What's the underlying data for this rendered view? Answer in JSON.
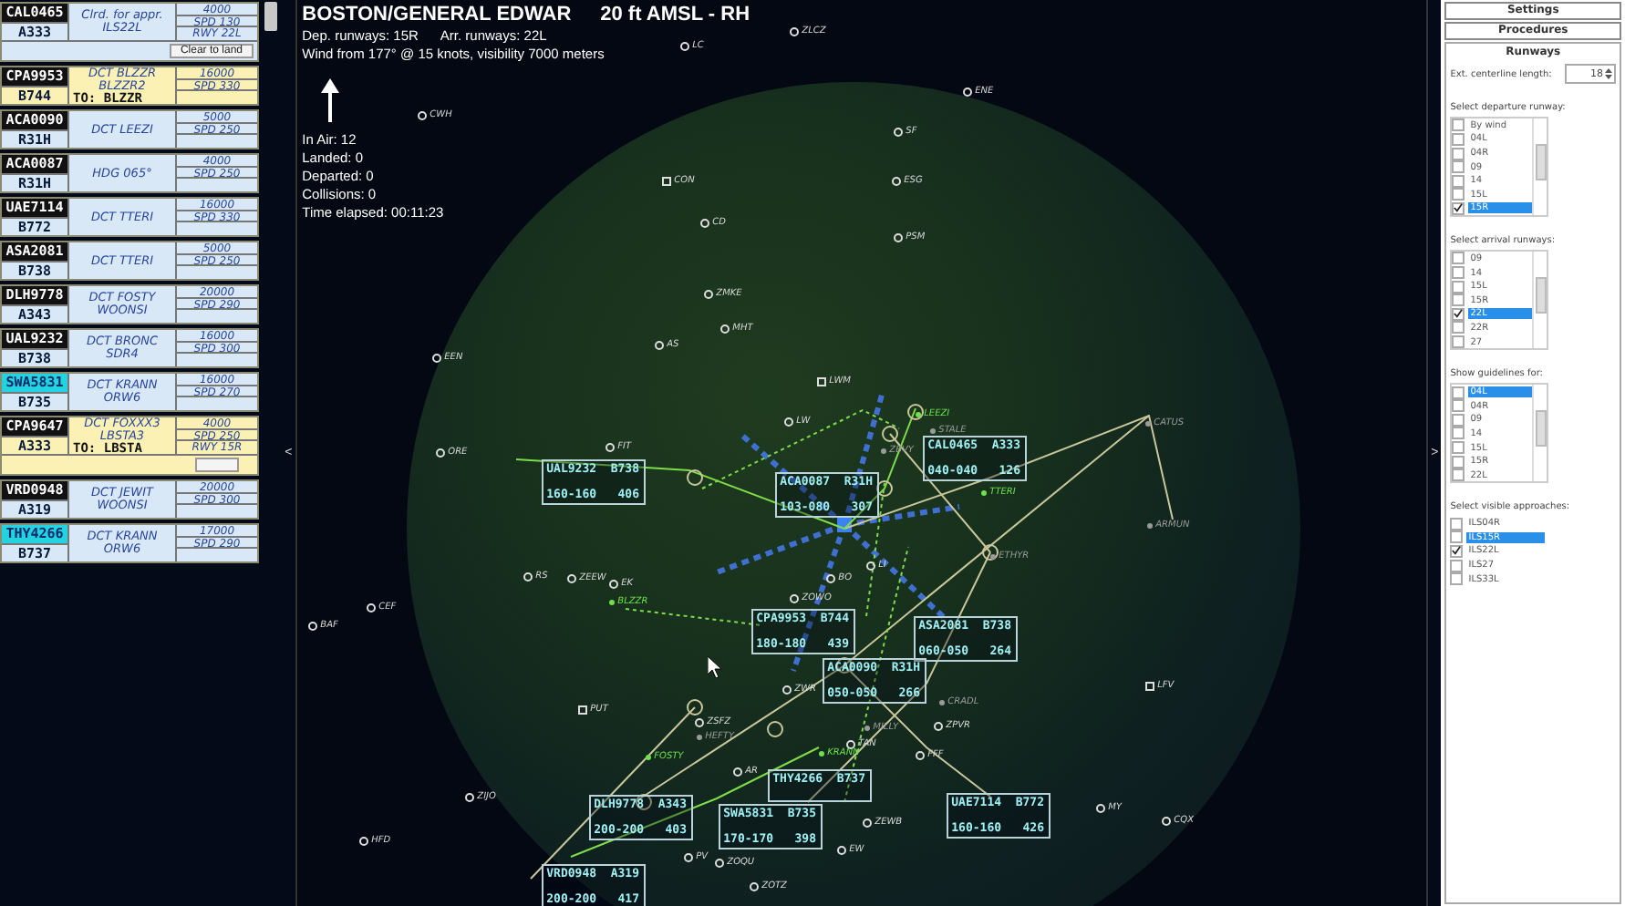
{
  "strips_panel": {
    "strips": [
      {
        "callsign": "CAL0465",
        "type": "A333",
        "kind": "arrival",
        "highlighted": false,
        "route": [
          "Clrd. for appr.",
          "ILS22L"
        ],
        "altitude": "4000",
        "speed": "SPD 130",
        "runway": "RWY 22L",
        "button": "Clear to land"
      },
      {
        "callsign": "CPA9953",
        "type": "B744",
        "kind": "departure",
        "highlighted": false,
        "route": [
          "DCT BLZZR",
          "BLZZR2"
        ],
        "destination": "TO: BLZZR",
        "altitude": "16000",
        "speed": "SPD 330"
      },
      {
        "callsign": "ACA0090",
        "type": "R31H",
        "kind": "arrival",
        "highlighted": false,
        "route": [
          "DCT LEEZI"
        ],
        "altitude": "5000",
        "speed": "SPD 250"
      },
      {
        "callsign": "ACA0087",
        "type": "R31H",
        "kind": "arrival",
        "highlighted": false,
        "route": [
          "HDG 065°"
        ],
        "altitude": "4000",
        "speed": "SPD 250"
      },
      {
        "callsign": "UAE7114",
        "type": "B772",
        "kind": "arrival",
        "highlighted": false,
        "route": [
          "DCT TTERI"
        ],
        "altitude": "16000",
        "speed": "SPD 330"
      },
      {
        "callsign": "ASA2081",
        "type": "B738",
        "kind": "arrival",
        "highlighted": false,
        "route": [
          "DCT TTERI"
        ],
        "altitude": "5000",
        "speed": "SPD 250"
      },
      {
        "callsign": "DLH9778",
        "type": "A343",
        "kind": "arrival",
        "highlighted": false,
        "route": [
          "DCT FOSTY",
          "WOONSI"
        ],
        "altitude": "20000",
        "speed": "SPD 290"
      },
      {
        "callsign": "UAL9232",
        "type": "B738",
        "kind": "arrival",
        "highlighted": false,
        "route": [
          "DCT BRONC",
          "SDR4"
        ],
        "altitude": "16000",
        "speed": "SPD 300"
      },
      {
        "callsign": "SWA5831",
        "type": "B735",
        "kind": "arrival",
        "highlighted": true,
        "route": [
          "DCT KRANN",
          "ORW6"
        ],
        "altitude": "16000",
        "speed": "SPD 270"
      },
      {
        "callsign": "CPA9647",
        "type": "A333",
        "kind": "departure",
        "highlighted": false,
        "route": [
          "DCT FOXXX3",
          "LBSTA3"
        ],
        "destination": "TO: LBSTA",
        "altitude": "4000",
        "speed": "SPD 250",
        "runway": "RWY 15R",
        "blank_button": true
      },
      {
        "callsign": "VRD0948",
        "type": "A319",
        "kind": "arrival",
        "highlighted": false,
        "route": [
          "DCT JEWIT",
          "WOONSI"
        ],
        "altitude": "20000",
        "speed": "SPD 300"
      },
      {
        "callsign": "THY4266",
        "type": "B737",
        "kind": "arrival",
        "highlighted": true,
        "route": [
          "DCT KRANN",
          "ORW6"
        ],
        "altitude": "17000",
        "speed": "SPD 290"
      }
    ]
  },
  "toggle_left": "<",
  "toggle_right": ">",
  "radar": {
    "airport": "BOSTON/GENERAL EDWAR",
    "elevation": "20 ft AMSL - RH",
    "dep_runways": "Dep. runways: 15R",
    "arr_runways": "Arr. runways: 22L",
    "wind": "Wind from 177° @ 15 knots, visibility 7000 meters",
    "stats": [
      "In Air: 12",
      "Landed: 0",
      "Departed: 0",
      "Collisions: 0",
      "Time elapsed: 00:11:23"
    ],
    "navaids": [
      {
        "label": "ZLCZ",
        "kind": "vor"
      },
      {
        "label": "LC",
        "kind": "vor"
      },
      {
        "label": "CWH",
        "kind": "vor"
      },
      {
        "label": "ENE",
        "kind": "vor"
      },
      {
        "label": "SF",
        "kind": "vor"
      },
      {
        "label": "CON",
        "kind": "airport"
      },
      {
        "label": "ESG",
        "kind": "vor"
      },
      {
        "label": "CD",
        "kind": "vor"
      },
      {
        "label": "PSM",
        "kind": "vor"
      },
      {
        "label": "ZMKE",
        "kind": "vor"
      },
      {
        "label": "MHT",
        "kind": "vor"
      },
      {
        "label": "AS",
        "kind": "vor"
      },
      {
        "label": "EEN",
        "kind": "vor"
      },
      {
        "label": "LWM",
        "kind": "airport"
      },
      {
        "label": "LW",
        "kind": "vor"
      },
      {
        "label": "FIT",
        "kind": "vor"
      },
      {
        "label": "ORE",
        "kind": "vor"
      },
      {
        "label": "RS",
        "kind": "vor"
      },
      {
        "label": "ZEEW",
        "kind": "vor"
      },
      {
        "label": "EK",
        "kind": "vor"
      },
      {
        "label": "BAF",
        "kind": "vor"
      },
      {
        "label": "CEF",
        "kind": "vor"
      },
      {
        "label": "ZOWO",
        "kind": "vor"
      },
      {
        "label": "BO",
        "kind": "vor"
      },
      {
        "label": "LI",
        "kind": "vor"
      },
      {
        "label": "ZWR",
        "kind": "vor"
      },
      {
        "label": "PUT",
        "kind": "airport"
      },
      {
        "label": "ZSFZ",
        "kind": "vor"
      },
      {
        "label": "AR",
        "kind": "vor"
      },
      {
        "label": "TAN",
        "kind": "vor"
      },
      {
        "label": "ZPVR",
        "kind": "vor"
      },
      {
        "label": "FFF",
        "kind": "vor"
      },
      {
        "label": "ZEWB",
        "kind": "vor"
      },
      {
        "label": "EW",
        "kind": "vor"
      },
      {
        "label": "PV",
        "kind": "vor"
      },
      {
        "label": "ZOQU",
        "kind": "vor"
      },
      {
        "label": "ZOTZ",
        "kind": "vor"
      },
      {
        "label": "ZIJO",
        "kind": "vor"
      },
      {
        "label": "HFD",
        "kind": "vor"
      },
      {
        "label": "LFV",
        "kind": "airport"
      },
      {
        "label": "MY",
        "kind": "vor"
      },
      {
        "label": "CQX",
        "kind": "vor"
      }
    ],
    "fixes": [
      {
        "label": "LEEZI",
        "kind": "active"
      },
      {
        "label": "BLZZR",
        "kind": "active"
      },
      {
        "label": "FOSTY",
        "kind": "active"
      },
      {
        "label": "KRANN",
        "kind": "active"
      },
      {
        "label": "TTERI",
        "kind": "active"
      },
      {
        "label": "STALE",
        "kind": "inactive"
      },
      {
        "label": "ZBVY",
        "kind": "inactive"
      },
      {
        "label": "ETHYR",
        "kind": "inactive"
      },
      {
        "label": "CRADL",
        "kind": "inactive"
      },
      {
        "label": "CATUS",
        "kind": "inactive"
      },
      {
        "label": "ARMUN",
        "kind": "inactive"
      },
      {
        "label": "MILLY",
        "kind": "inactive"
      },
      {
        "label": "HEFTY",
        "kind": "inactive"
      }
    ],
    "tags": [
      {
        "line1": "UAL9232  B738",
        "line2": "160-160   406"
      },
      {
        "line1": "ACA0087  R31H",
        "line2": "103-080   307"
      },
      {
        "line1": "CAL0465  A333",
        "line2": "040-040   126"
      },
      {
        "line1": "CPA9953  B744",
        "line2": "180-180   439"
      },
      {
        "line1": "ASA2081  B738",
        "line2": "060-050   264"
      },
      {
        "line1": "ACA0090  R31H",
        "line2": "050-050   266"
      },
      {
        "line1": "DLH9778  A343",
        "line2": "200-200   403"
      },
      {
        "line1": "THY4266  B737"
      },
      {
        "line1": "SWA5831  B735",
        "line2": "170-170   398"
      },
      {
        "line1": "UAE7114  B772",
        "line2": "160-160   426"
      },
      {
        "line1": "VRD0948  A319",
        "line2": "200-200   417"
      }
    ]
  },
  "side_panel": {
    "buttons": [
      "Settings",
      "Procedures"
    ],
    "group_title": "Runways",
    "centerline": {
      "label": "Ext. centerline length:",
      "value": "18"
    },
    "lists": [
      {
        "title": "Select departure runway:",
        "kind": "scroll",
        "items": [
          {
            "label": "By wind",
            "checked": false,
            "selected": false
          },
          {
            "label": "04L",
            "checked": false,
            "selected": false
          },
          {
            "label": "04R",
            "checked": false,
            "selected": false
          },
          {
            "label": "09",
            "checked": false,
            "selected": false
          },
          {
            "label": "14",
            "checked": false,
            "selected": false
          },
          {
            "label": "15L",
            "checked": false,
            "selected": false
          },
          {
            "label": "15R",
            "checked": true,
            "selected": true
          }
        ]
      },
      {
        "title": "Select arrival runways:",
        "kind": "scroll",
        "items": [
          {
            "label": "09",
            "checked": false,
            "selected": false
          },
          {
            "label": "14",
            "checked": false,
            "selected": false
          },
          {
            "label": "15L",
            "checked": false,
            "selected": false
          },
          {
            "label": "15R",
            "checked": false,
            "selected": false
          },
          {
            "label": "22L",
            "checked": true,
            "selected": true
          },
          {
            "label": "22R",
            "checked": false,
            "selected": false
          },
          {
            "label": "27",
            "checked": false,
            "selected": false
          }
        ]
      },
      {
        "title": "Show guidelines for:",
        "kind": "scroll",
        "items": [
          {
            "label": "04L",
            "checked": false,
            "selected": true
          },
          {
            "label": "04R",
            "checked": false,
            "selected": false
          },
          {
            "label": "09",
            "checked": false,
            "selected": false
          },
          {
            "label": "14",
            "checked": false,
            "selected": false
          },
          {
            "label": "15L",
            "checked": false,
            "selected": false
          },
          {
            "label": "15R",
            "checked": false,
            "selected": false
          },
          {
            "label": "22L",
            "checked": false,
            "selected": false
          }
        ]
      },
      {
        "title": "Select visible approaches:",
        "kind": "plain",
        "items": [
          {
            "label": "ILS04R",
            "checked": false,
            "selected": false
          },
          {
            "label": "ILS15R",
            "checked": false,
            "selected": true
          },
          {
            "label": "ILS22L",
            "checked": true,
            "selected": false
          },
          {
            "label": "ILS27",
            "checked": false,
            "selected": false
          },
          {
            "label": "ILS33L",
            "checked": false,
            "selected": false
          }
        ]
      }
    ]
  }
}
